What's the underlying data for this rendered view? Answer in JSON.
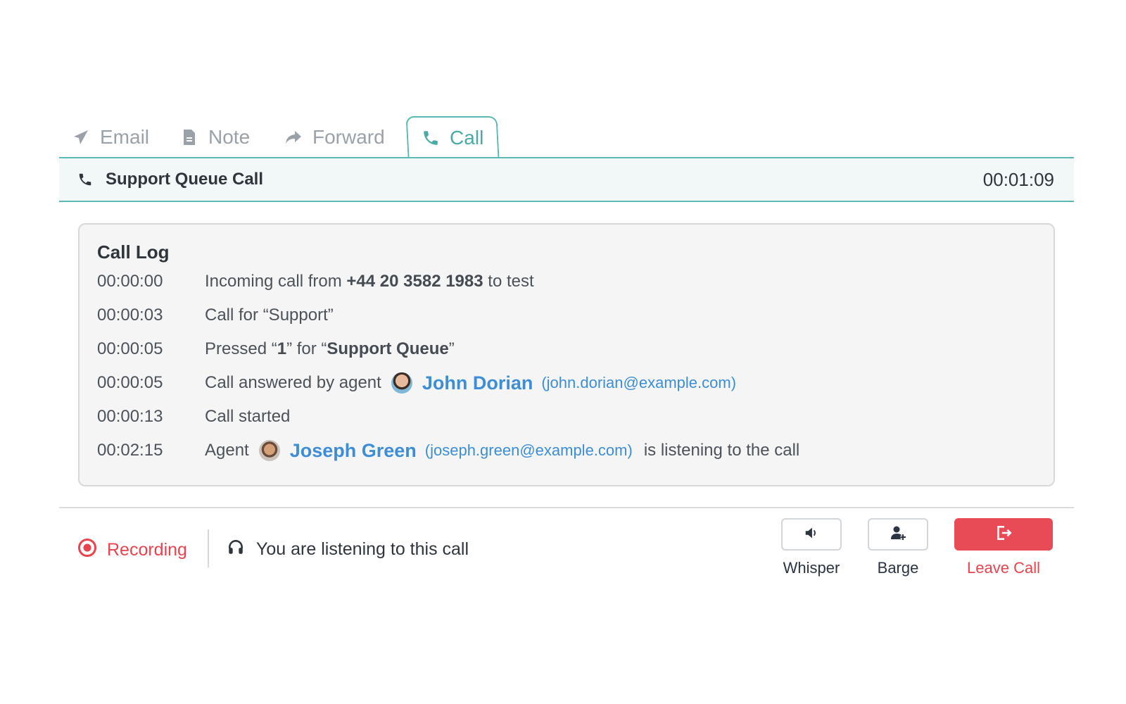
{
  "tabs": [
    {
      "label": "Email",
      "icon": "paper-plane-icon"
    },
    {
      "label": "Note",
      "icon": "document-icon"
    },
    {
      "label": "Forward",
      "icon": "forward-arrow-icon"
    },
    {
      "label": "Call",
      "icon": "phone-icon",
      "active": true
    }
  ],
  "header": {
    "icon": "phone-icon",
    "title": "Support Queue Call",
    "timer": "00:01:09"
  },
  "call_log": {
    "title": "Call Log",
    "entries": [
      {
        "time": "00:00:00",
        "pre": "Incoming call from ",
        "bold": "+44 20 3582 1983",
        "post": " to test"
      },
      {
        "time": "00:00:03",
        "text": "Call for “Support”"
      },
      {
        "time": "00:00:05",
        "pre": "Pressed “",
        "bold1": "1",
        "mid": "” for “",
        "bold2": "Support Queue",
        "post": "”"
      },
      {
        "time": "00:00:05",
        "pre": "Call answered by agent",
        "agent_name": "John Dorian",
        "agent_email": "(john.dorian@example.com)"
      },
      {
        "time": "00:00:13",
        "text": "Call started"
      },
      {
        "time": "00:02:15",
        "pre": "Agent",
        "agent_name": "Joseph Green",
        "agent_email": "(joseph.green@example.com)",
        "post": "is listening to the call"
      }
    ]
  },
  "footer": {
    "recording_label": "Recording",
    "listening_text": "You are listening to this call",
    "actions": [
      {
        "label": "Whisper",
        "icon": "speaker-icon"
      },
      {
        "label": "Barge",
        "icon": "add-user-icon"
      },
      {
        "label": "Leave Call",
        "icon": "exit-icon"
      }
    ]
  },
  "colors": {
    "accent": "#5cb8b2",
    "link": "#3d8ed6",
    "danger": "#e84a56",
    "header_bg": "#f2f8f8",
    "log_bg": "#f5f5f5"
  }
}
